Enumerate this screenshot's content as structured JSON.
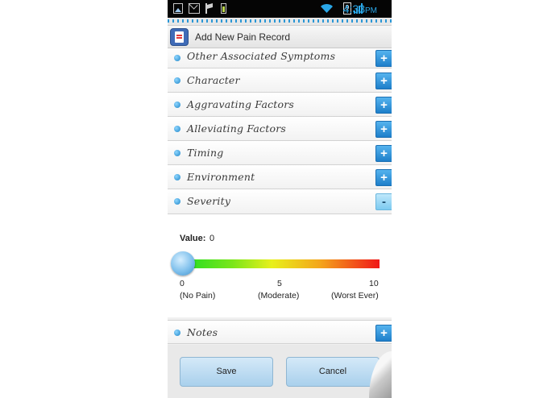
{
  "status_bar": {
    "time": "4:33",
    "time_suffix": "PM",
    "battery_level": "9",
    "icons": [
      "image-icon",
      "mail-icon",
      "flag-icon",
      "battery-charging-icon",
      "wifi-icon",
      "signal-icon",
      "battery-icon"
    ]
  },
  "header": {
    "title": "Add New Pain Record",
    "icon": "notebook-icon"
  },
  "sections": [
    {
      "label": "Other Associated Symptoms",
      "toggle": "+"
    },
    {
      "label": "Character",
      "toggle": "+"
    },
    {
      "label": "Aggravating Factors",
      "toggle": "+"
    },
    {
      "label": "Alleviating Factors",
      "toggle": "+"
    },
    {
      "label": "Timing",
      "toggle": "+"
    },
    {
      "label": "Environment",
      "toggle": "+"
    },
    {
      "label": "Severity",
      "toggle": "-"
    }
  ],
  "severity": {
    "value_label": "Value:",
    "value": "0",
    "slider_value": 0,
    "scale": {
      "min": "0",
      "mid": "5",
      "max": "10",
      "min_desc": "(No Pain)",
      "mid_desc": "(Moderate)",
      "max_desc": "(Worst Ever)"
    },
    "colors": {
      "low": "#22dd22",
      "mid": "#e8f01c",
      "high": "#f01818"
    }
  },
  "notes": {
    "label": "Notes",
    "toggle": "+"
  },
  "actions": {
    "save_label": "Save",
    "cancel_label": "Cancel"
  },
  "colors": {
    "accent": "#2c97d6",
    "button_fill": "#b9dcf3"
  }
}
